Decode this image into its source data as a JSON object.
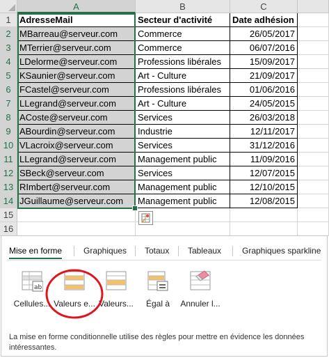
{
  "columns": [
    "A",
    "B",
    "C"
  ],
  "rows": [
    "1",
    "2",
    "3",
    "4",
    "5",
    "6",
    "7",
    "8",
    "9",
    "10",
    "11",
    "12",
    "13",
    "14",
    "15",
    "16"
  ],
  "headers": [
    "AdresseMail",
    "Secteur d'activité",
    "Date adhésion"
  ],
  "data": [
    [
      "MBarreau@serveur.com",
      "Commerce",
      "26/05/2017"
    ],
    [
      "MTerrier@serveur.com",
      "Commerce",
      "06/07/2016"
    ],
    [
      "LDelorme@serveur.com",
      "Professions libérales",
      "15/09/2017"
    ],
    [
      "KSaunier@serveur.com",
      "Art - Culture",
      "21/09/2017"
    ],
    [
      "FCastel@serveur.com",
      "Professions libérales",
      "01/06/2016"
    ],
    [
      "LLegrand@serveur.com",
      "Art - Culture",
      "24/05/2015"
    ],
    [
      "ACoste@serveur.com",
      "Services",
      "26/03/2018"
    ],
    [
      "ABourdin@serveur.com",
      "Industrie",
      "12/11/2017"
    ],
    [
      "VLacroix@serveur.com",
      "Services",
      "31/12/2016"
    ],
    [
      "LLegrand@serveur.com",
      "Management public",
      "11/09/2016"
    ],
    [
      "SBeck@serveur.com",
      "Services",
      "12/07/2015"
    ],
    [
      "RImbert@serveur.com",
      "Management public",
      "12/10/2015"
    ],
    [
      "JGuillaume@serveur.com",
      "Management public",
      "12/08/2015"
    ]
  ],
  "quick_analysis": {
    "tabs": [
      "Mise en forme",
      "Graphiques",
      "Totaux",
      "Tableaux",
      "Graphiques sparkline"
    ],
    "options": [
      {
        "label": "Cellules...",
        "icon": "text-contains-icon"
      },
      {
        "label": "Valeurs e...",
        "icon": "duplicate-values-icon"
      },
      {
        "label": "Valeurs...",
        "icon": "unique-values-icon"
      },
      {
        "label": "Égal à",
        "icon": "equal-to-icon"
      },
      {
        "label": "Annuler l...",
        "icon": "clear-format-icon"
      }
    ],
    "description": "La mise en forme conditionnelle utilise des règles pour mettre en évidence les données intéressantes."
  },
  "colors": {
    "accent": "#217346",
    "selection": "#d3d3d3",
    "highlight_circle": "#e0141e"
  }
}
